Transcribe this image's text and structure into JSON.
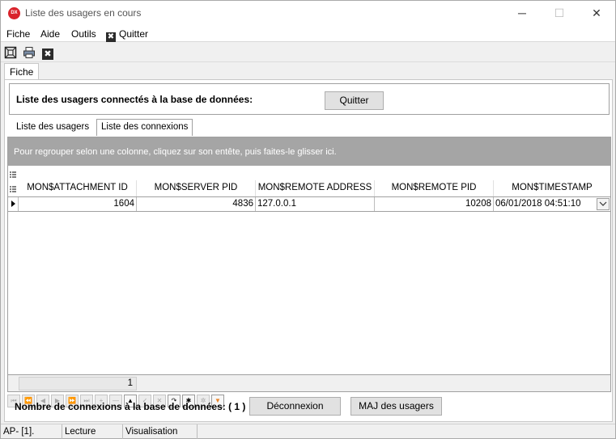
{
  "window": {
    "app_icon": "DX",
    "title": "Liste des usagers en cours",
    "min": "─",
    "max": "☐",
    "close": "✕"
  },
  "menu": {
    "items": [
      "Fiche",
      "Aide",
      "Outils"
    ],
    "quit_label": "Quitter",
    "quit_icon": "✖"
  },
  "toolbar": {
    "icons": [
      "frame-icon",
      "print-icon",
      "close-icon"
    ],
    "close_glyph": "✖"
  },
  "main_tab": "Fiche",
  "header": {
    "label": "Liste des usagers connectés à la base de données:",
    "quit_button": "Quitter"
  },
  "tabs": [
    "Liste des usagers",
    "Liste des connexions"
  ],
  "grid": {
    "group_hint": "Pour regrouper selon une colonne, cliquez sur son entête, puis faites-le glisser ici.",
    "columns": [
      "MON$ATTACHMENT ID",
      "MON$SERVER PID",
      "MON$REMOTE ADDRESS",
      "MON$REMOTE PID",
      "MON$TIMESTAMP"
    ],
    "rows": [
      [
        "1604",
        "4836",
        "127.0.0.1",
        "10208",
        "06/01/2018 04:51:10"
      ]
    ],
    "footer_count": "1"
  },
  "navigator": {
    "buttons": [
      "⏮",
      "⏪",
      "◀",
      "▶",
      "⏩",
      "⏭",
      "+",
      "—",
      "▲",
      "✓",
      "✕",
      "↷",
      "✱",
      "✲",
      "▼"
    ]
  },
  "bottom": {
    "count_label": "Nombre de connexions à la base de données: ( 1 )",
    "disconnect_button": "Déconnexion",
    "update_button": "MAJ des usagers"
  },
  "status": [
    "AP- [1].",
    "Lecture",
    "Visualisation"
  ],
  "colors": {
    "group_panel": "#a5a5a5",
    "filter_icon": "#e8862a",
    "app_icon": "#d9232b"
  }
}
